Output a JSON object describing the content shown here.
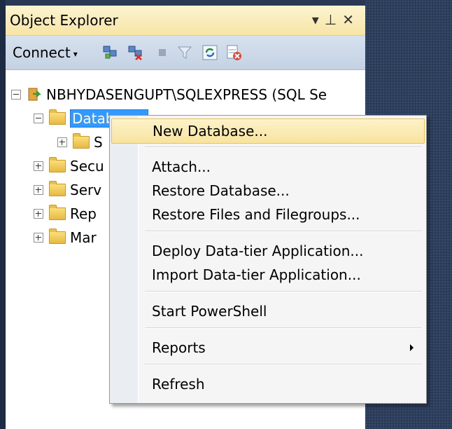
{
  "window": {
    "title": "Object Explorer",
    "title_controls": [
      "▾",
      "⊥",
      "✕"
    ]
  },
  "toolbar": {
    "connect_label": "Connect",
    "connect_caret": "▾",
    "icons": [
      "connect-object-explorer-icon",
      "disconnect-icon",
      "stop-icon",
      "filter-icon",
      "refresh-icon",
      "activity-monitor-icon"
    ]
  },
  "tree": {
    "server": "NBHYDASENGUPT\\SQLEXPRESS (SQL Se",
    "databases": "Databases",
    "system_databases": "S",
    "security": "Secu",
    "server_objects": "Serv",
    "replication": "Rep",
    "management": "Mar"
  },
  "context_menu": {
    "items": [
      {
        "label": "New Database...",
        "highlighted": true
      },
      {
        "label": "Attach..."
      },
      {
        "label": "Restore Database..."
      },
      {
        "label": "Restore Files and Filegroups..."
      },
      {
        "label": "Deploy Data-tier Application..."
      },
      {
        "label": "Import Data-tier Application..."
      },
      {
        "label": "Start PowerShell"
      },
      {
        "label": "Reports",
        "has_submenu": true
      },
      {
        "label": "Refresh"
      }
    ]
  },
  "colors": {
    "frame": "#293955",
    "title_bar": "#f6e5a6",
    "toolbar": "#cbd7e8",
    "selection": "#3399ff",
    "menu_highlight": "#f8e39f"
  }
}
